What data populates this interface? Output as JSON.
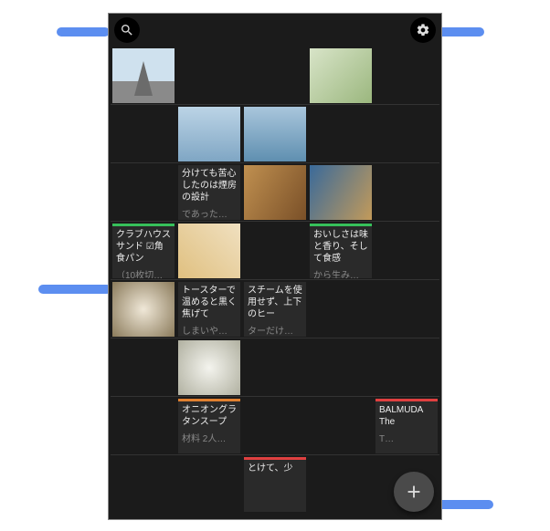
{
  "colors": {
    "accent_green": "#36c05a",
    "accent_red": "#e04040",
    "accent_orange": "#e08030",
    "annotation_blue": "#5c8ef0"
  },
  "icons": {
    "search": "search-icon",
    "settings": "gear-icon",
    "add": "plus-icon"
  },
  "rows": [
    {
      "cards": [
        {
          "col": 0,
          "kind": "image",
          "img": "cathedral"
        },
        {
          "col": 3,
          "kind": "image",
          "img": "people"
        }
      ]
    },
    {
      "cards": [
        {
          "col": 1,
          "kind": "image",
          "img": "arch1"
        },
        {
          "col": 2,
          "kind": "image",
          "img": "arch2"
        }
      ]
    },
    {
      "cards": [
        {
          "col": 1,
          "kind": "text",
          "text": "分けても苦心したのは煙房の設計",
          "more": "であった…"
        },
        {
          "col": 2,
          "kind": "image",
          "img": "ham"
        },
        {
          "col": 3,
          "kind": "image",
          "img": "market"
        }
      ]
    },
    {
      "cards": [
        {
          "col": 0,
          "kind": "text",
          "bar": "accent_green",
          "text": "クラブハウスサンド\n☑角食パン",
          "more": "（10枚切…"
        },
        {
          "col": 1,
          "kind": "image",
          "img": "sand"
        },
        {
          "col": 3,
          "kind": "text",
          "bar": "accent_green",
          "text": "おいしさは味と香り、そして食感",
          "more": "から生み…"
        }
      ]
    },
    {
      "cards": [
        {
          "col": 0,
          "kind": "image",
          "img": "pastry"
        },
        {
          "col": 1,
          "kind": "text",
          "text": "トースターで温めると黒く焦げて",
          "more": "しまいや…"
        },
        {
          "col": 2,
          "kind": "text",
          "text": "スチームを使用せず、上下のヒー",
          "more": "ターだけ…"
        }
      ]
    },
    {
      "cards": [
        {
          "col": 1,
          "kind": "image",
          "img": "garlic"
        }
      ]
    },
    {
      "cards": [
        {
          "col": 1,
          "kind": "text",
          "bar": "accent_orange",
          "text": "オニオングラタンスープ",
          "more": "材料 2人…"
        },
        {
          "col": 4,
          "kind": "text",
          "bar": "accent_red",
          "text": "BALMUDA The",
          "more": "T…"
        }
      ]
    },
    {
      "cards": [
        {
          "col": 2,
          "kind": "text",
          "bar": "accent_red",
          "text": "とけて、少"
        }
      ]
    }
  ]
}
